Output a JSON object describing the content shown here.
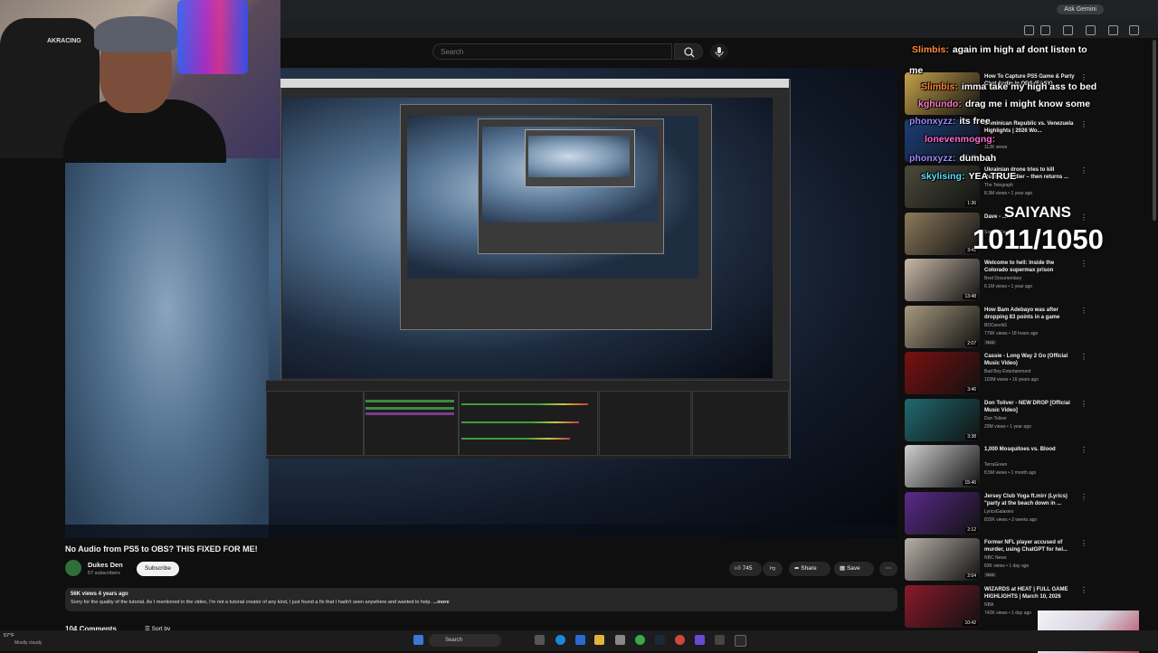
{
  "browser": {
    "gemini_label": "Ask Gemini"
  },
  "header": {
    "search_placeholder": "Search"
  },
  "webcam": {
    "chair_brand": "AKRACING"
  },
  "video": {
    "title": "No Audio from PS5 to OBS? THIS FIXED FOR ME!",
    "channel": "Dukes Den",
    "subscribers": "57 subscribers",
    "subscribe_label": "Subscribe",
    "likes": "745",
    "share_label": "Share",
    "save_label": "Save",
    "description_meta": "56K views  4 years ago",
    "description": "Sorry for the quality of the tutorial. As I mentioned in the video, I'm not a tutorial creator of any kind, I just found a fix that I hadn't seen anywhere and wanted to help.",
    "more_label": "...more",
    "comments_count": "104 Comments",
    "sort_label": "Sort by"
  },
  "recommendations": [
    {
      "title": "How To Capture PS5 Game & Party Chat Audio in OBS (EASY)",
      "channel": "",
      "meta": "",
      "duration": "",
      "thumb": "#c6a24a"
    },
    {
      "title": "Dominican Republic vs. Venezuela Highlights | 2026 Wo...",
      "channel": "",
      "meta": "112K views",
      "duration": "21:32",
      "thumb": "#1c3f7a"
    },
    {
      "title": "Ukrainian drone tries to kill Russian soldier – then returns ...",
      "channel": "The Telegraph",
      "meta": "8.3M views • 1 year ago",
      "duration": "1:36",
      "thumb": "#4a4a3c"
    },
    {
      "title": "Dave - ...",
      "channel": "Santan Dave",
      "meta": "",
      "duration": "3:41",
      "thumb": "#8c7a5c"
    },
    {
      "title": "Welcome to hell: Inside the Colorado supermax prison",
      "channel": "Best Documentary",
      "meta": "6.1M views • 1 year ago",
      "duration": "13:48",
      "thumb": "#c9b8a8"
    },
    {
      "title": "How Bam Adebayo was after dropping 83 points in a game",
      "channel": "BDCworld1",
      "meta": "779K views • 18 hours ago",
      "duration": "2:07",
      "thumb": "#a89a80",
      "badge": "New"
    },
    {
      "title": "Cassie - Long Way 2 Go (Official Music Video)",
      "channel": "Bad Boy Entertainment",
      "meta": "103M views • 16 years ago",
      "duration": "3:46",
      "thumb": "#7a1010"
    },
    {
      "title": "Don Toliver - NEW DROP [Official Music Video]",
      "channel": "Don Toliver",
      "meta": "20M views • 1 year ago",
      "duration": "3:38",
      "thumb": "#1f6a70"
    },
    {
      "title": "1,000 Mosquitoes vs. Blood",
      "channel": "TerraGreen",
      "meta": "8.5M views • 1 month ago",
      "duration": "15:46",
      "thumb": "#d0d0d0"
    },
    {
      "title": "Jersey Club Yoga ft.mirr (Lyrics) \"party at the beach down in ...",
      "channel": "LyricsGalaxies",
      "meta": "815K views • 2 weeks ago",
      "duration": "2:12",
      "thumb": "#5a2a8a"
    },
    {
      "title": "Former NFL player accused of murder, using ChatGPT for hel...",
      "channel": "NBC News",
      "meta": "83K views • 1 day ago",
      "duration": "2:04",
      "thumb": "#b8b0a8",
      "badge": "New"
    },
    {
      "title": "WIZARDS at HEAT | FULL GAME HIGHLIGHTS | March 10, 2026",
      "channel": "NBA",
      "meta": "742K views • 1 day ago",
      "duration": "10:42",
      "thumb": "#8a1a2a"
    }
  ],
  "chat": [
    {
      "user": "Slimbis:",
      "message": "again im high af",
      "extra": "dont listen to",
      "user_color": "#ff8a3a"
    },
    {
      "user": "",
      "message": "me",
      "user_color": "#ffffff"
    },
    {
      "user": "Slimbis:",
      "message": "imma take my high ass to bed",
      "user_color": "#ff8a3a"
    },
    {
      "user": "kghundo:",
      "message": "drag me i might know some",
      "user_color": "#ff7ac8"
    },
    {
      "user": "phonxyzz:",
      "message": "its free",
      "user_color": "#9a8cff"
    },
    {
      "user": "lonevenmogng:",
      "message": "",
      "user_color": "#ff6ad5"
    },
    {
      "user": "phonxyzz:",
      "message": "dumbah",
      "user_color": "#9a8cff"
    },
    {
      "user": "skylising:",
      "message": "YEA TRUE",
      "user_color": "#5ae0ff"
    }
  ],
  "goal": {
    "title": "SAIYANS",
    "count": "1011/1050"
  },
  "taskbar": {
    "weather_temp": "57°F",
    "weather_desc": "Mostly cloudy",
    "search_label": "Search"
  },
  "colors": {
    "background": "#0f0f0f",
    "surface": "#272727",
    "text": "#f1f1f1"
  }
}
